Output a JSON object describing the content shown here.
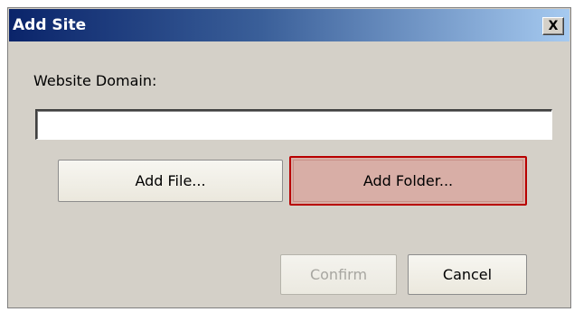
{
  "window": {
    "title": "Add Site",
    "close_label": "X"
  },
  "form": {
    "domain_label": "Website Domain:",
    "domain_value": "",
    "domain_placeholder": ""
  },
  "buttons": {
    "add_file": "Add File...",
    "add_folder": "Add Folder...",
    "confirm": "Confirm",
    "cancel": "Cancel"
  },
  "state": {
    "confirm_enabled": false,
    "focused_button": "add_folder"
  },
  "colors": {
    "titlebar_start": "#0a246a",
    "titlebar_end": "#a6caf0",
    "dialog_bg": "#d4d0c8",
    "focus_border": "#b80000",
    "focus_fill": "#d8aea6"
  }
}
